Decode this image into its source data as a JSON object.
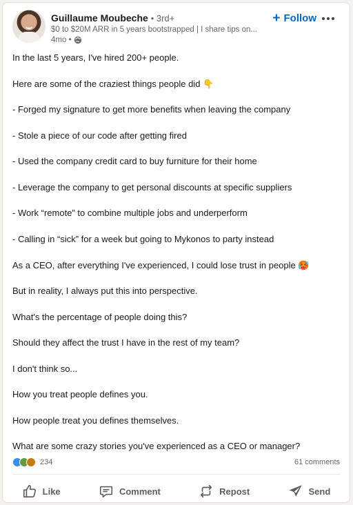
{
  "post": {
    "author": {
      "name": "Guillaume Moubeche",
      "degree": "• 3rd+",
      "headline": "$0 to $20M ARR in 5 years bootstrapped | I share tips on...",
      "time": "4mo •"
    },
    "follow_label": "Follow",
    "paragraphs": [
      "In the last 5 years, I've hired 200+ people.",
      "Here are some of the craziest things people did 👇",
      "- Forged my signature to get more benefits when leaving the company",
      "- Stole a piece of our code after getting fired",
      "- Used the company credit card to buy furniture for their home",
      "- Leverage the company to get personal discounts at specific suppliers",
      "- Work “remote” to combine multiple jobs and underperform",
      "- Calling in “sick” for a week but going to Mykonos to party instead",
      "As a CEO, after everything I've experienced, I could lose trust in people 🥵",
      "But in reality, I always put this into perspective.",
      "What's the percentage of people doing this?",
      "Should they affect the trust I have in the rest of my team?",
      "I don't think so...",
      "How you treat people defines you.",
      "How people treat you defines themselves.",
      "What are some crazy stories you've experienced as a CEO or manager?"
    ],
    "reaction_count": "234",
    "comments_count": "61 comments",
    "actions": {
      "like": "Like",
      "comment": "Comment",
      "repost": "Repost",
      "send": "Send"
    }
  },
  "icons": {
    "visibility": "globe-icon",
    "reactions": [
      "like-icon",
      "celebrate-icon",
      "love-icon"
    ]
  },
  "colors": {
    "accent": "#0a66c2",
    "text": "#191919",
    "secondary": "#666666"
  }
}
